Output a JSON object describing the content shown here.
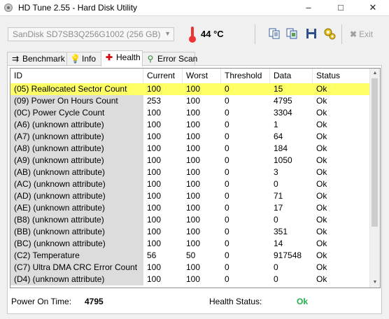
{
  "window": {
    "title": "HD Tune 2.55 - Hard Disk Utility",
    "minimize_icon": "minimize-icon",
    "maximize_icon": "maximize-icon",
    "close_icon": "close-icon"
  },
  "toolbar": {
    "drive": "SanDisk  SD7SB3Q256G1002 (256 GB)",
    "temperature": "44 °C",
    "exit_label": "Exit",
    "icons": [
      "copy-text-icon",
      "copy-screenshot-icon",
      "save-icon",
      "options-icon",
      "exit-icon"
    ]
  },
  "tabs": [
    {
      "label": "Benchmark",
      "icon": "benchmark-icon"
    },
    {
      "label": "Info",
      "icon": "info-icon"
    },
    {
      "label": "Health",
      "icon": "health-cross-icon"
    },
    {
      "label": "Error Scan",
      "icon": "magnifier-icon"
    }
  ],
  "active_tab": "Health",
  "colors": {
    "highlight_row": "#ffff66",
    "ok_status": "#22b14c",
    "id_column_bg": "#dcdcdc"
  },
  "table": {
    "columns": [
      "ID",
      "Current",
      "Worst",
      "Threshold",
      "Data",
      "Status"
    ],
    "rows": [
      [
        "(05) Reallocated Sector Count",
        "100",
        "100",
        "0",
        "15",
        "Ok"
      ],
      [
        "(09) Power On Hours Count",
        "253",
        "100",
        "0",
        "4795",
        "Ok"
      ],
      [
        "(0C) Power Cycle Count",
        "100",
        "100",
        "0",
        "3304",
        "Ok"
      ],
      [
        "(A6) (unknown attribute)",
        "100",
        "100",
        "0",
        "1",
        "Ok"
      ],
      [
        "(A7) (unknown attribute)",
        "100",
        "100",
        "0",
        "64",
        "Ok"
      ],
      [
        "(A8) (unknown attribute)",
        "100",
        "100",
        "0",
        "184",
        "Ok"
      ],
      [
        "(A9) (unknown attribute)",
        "100",
        "100",
        "0",
        "1050",
        "Ok"
      ],
      [
        "(AB) (unknown attribute)",
        "100",
        "100",
        "0",
        "3",
        "Ok"
      ],
      [
        "(AC) (unknown attribute)",
        "100",
        "100",
        "0",
        "0",
        "Ok"
      ],
      [
        "(AD) (unknown attribute)",
        "100",
        "100",
        "0",
        "71",
        "Ok"
      ],
      [
        "(AE) (unknown attribute)",
        "100",
        "100",
        "0",
        "17",
        "Ok"
      ],
      [
        "(B8) (unknown attribute)",
        "100",
        "100",
        "0",
        "0",
        "Ok"
      ],
      [
        "(BB) (unknown attribute)",
        "100",
        "100",
        "0",
        "351",
        "Ok"
      ],
      [
        "(BC) (unknown attribute)",
        "100",
        "100",
        "0",
        "14",
        "Ok"
      ],
      [
        "(C2) Temperature",
        "56",
        "50",
        "0",
        "917548",
        "Ok"
      ],
      [
        "(C7) Ultra DMA CRC Error Count",
        "100",
        "100",
        "0",
        "0",
        "Ok"
      ],
      [
        "(D4) (unknown attribute)",
        "100",
        "100",
        "0",
        "0",
        "Ok"
      ]
    ]
  },
  "footer": {
    "power_on_time_label": "Power On Time:",
    "power_on_time_value": "4795",
    "health_status_label": "Health Status:",
    "health_status_value": "Ok"
  }
}
